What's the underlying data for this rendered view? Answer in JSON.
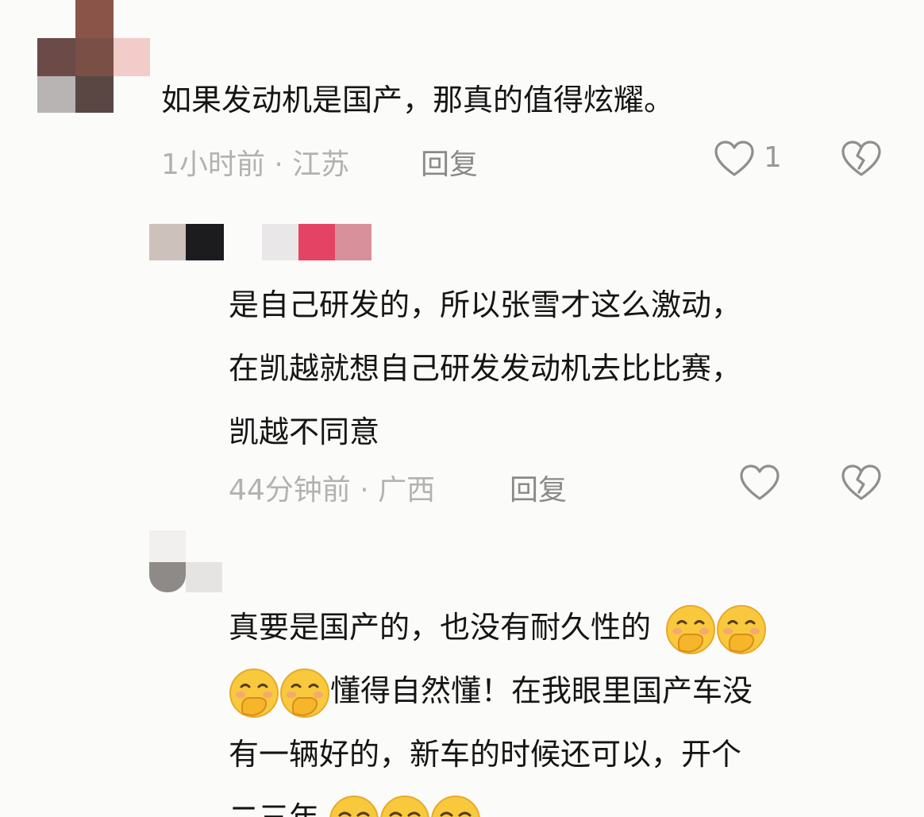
{
  "comments": [
    {
      "text_lines": [
        "如果发动机是国产，那真的值得炫耀。"
      ],
      "time": "1小时前",
      "location": "江苏",
      "reply_label": "回复",
      "like_count": "1"
    },
    {
      "text_lines": [
        "是自己研发的，所以张雪才这么激动，",
        "在凯越就想自己研发发动机去比比赛，",
        "凯越不同意"
      ],
      "time": "44分钟前",
      "location": "广西",
      "reply_label": "回复",
      "like_count": ""
    },
    {
      "text_lines": [
        "真要是国产的，也没有耐久性的",
        "懂得自然懂！在我眼里国产车没",
        "有一辆好的，新车的时候还可以，开个",
        "二三年"
      ],
      "emojis": [
        "covering-mouth-emoji",
        "covering-mouth-emoji",
        "covering-mouth-emoji",
        "covering-mouth-emoji",
        "crying-laughing-emoji",
        "crying-laughing-emoji",
        "crying-laughing-emoji"
      ]
    }
  ],
  "separator": " · ",
  "icons": {
    "like": "heart-outline-icon",
    "dislike": "broken-heart-icon"
  },
  "colors": {
    "text": "#151515",
    "meta": "#b2b2b2",
    "reply": "#8a8a8a",
    "icon": "#8f8f8f"
  }
}
